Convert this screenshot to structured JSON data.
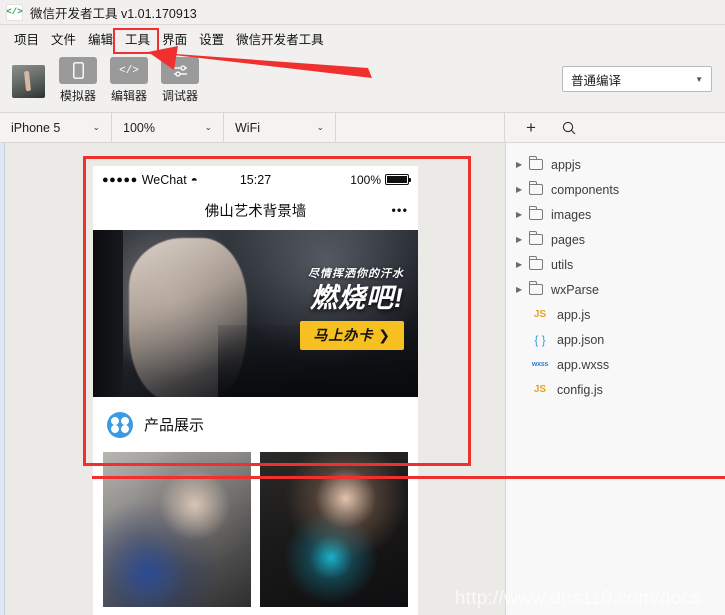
{
  "window": {
    "title": "微信开发者工具 v1.01.170913",
    "logo_icon": "code-brackets-icon"
  },
  "menubar": {
    "items": [
      {
        "label": "项目"
      },
      {
        "label": "文件"
      },
      {
        "label": "编辑"
      },
      {
        "label": "工具"
      },
      {
        "label": "界面"
      },
      {
        "label": "设置"
      },
      {
        "label": "微信开发者工具"
      }
    ]
  },
  "toolbar": {
    "avatar_name": "user-avatar",
    "buttons": [
      {
        "label": "模拟器",
        "icon": "phone-icon"
      },
      {
        "label": "编辑器",
        "icon": "code-icon"
      },
      {
        "label": "调试器",
        "icon": "sliders-icon"
      }
    ],
    "compile_mode": "普通编译"
  },
  "devicebar": {
    "device": "iPhone 5",
    "zoom": "100%",
    "network": "WiFi",
    "add_label": "+",
    "search_icon": "search-icon"
  },
  "simulator": {
    "status_bar": {
      "signal": "●●●●●",
      "carrier": "WeChat",
      "wifi": "wifi-icon",
      "time": "15:27",
      "battery_percent": "100%"
    },
    "nav": {
      "title": "佛山艺术背景墙",
      "menu_icon": "wechat-menu-dots"
    },
    "banner": {
      "subtitle": "尽情挥洒你的汗水",
      "headline": "燃烧吧!",
      "cta": "马上办卡 ❯",
      "cta_color": "#f6c020"
    },
    "section": {
      "icon": "flower-grid-icon",
      "icon_color": "#3b9ae1",
      "title": "产品展示"
    },
    "products": [
      {
        "name": "product-photo-1"
      },
      {
        "name": "product-photo-2"
      }
    ]
  },
  "tree": {
    "folders": [
      {
        "label": "appjs",
        "icon": "folder-icon",
        "twisty": "▶"
      },
      {
        "label": "components",
        "icon": "folder-icon",
        "twisty": "▶"
      },
      {
        "label": "images",
        "icon": "folder-icon",
        "twisty": "▶"
      },
      {
        "label": "pages",
        "icon": "folder-icon",
        "twisty": "▶"
      },
      {
        "label": "utils",
        "icon": "folder-icon",
        "twisty": "▶"
      },
      {
        "label": "wxParse",
        "icon": "folder-icon",
        "twisty": "▶"
      }
    ],
    "files": [
      {
        "label": "app.js",
        "badge": "JS",
        "kind": "js"
      },
      {
        "label": "app.json",
        "badge": "{ }",
        "kind": "json"
      },
      {
        "label": "app.wxss",
        "badge": "wxss",
        "kind": "wxss"
      },
      {
        "label": "config.js",
        "badge": "JS",
        "kind": "js"
      }
    ]
  },
  "annotations": {
    "color": "#f0302e",
    "menu_highlight": "工具",
    "watermark": "http://www.dns110.com/docs"
  }
}
